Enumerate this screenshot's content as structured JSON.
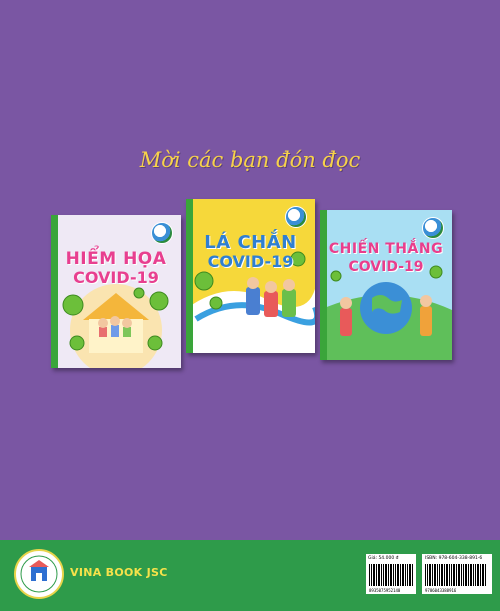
{
  "heading": "Mời các bạn đón đọc",
  "books": [
    {
      "title_line1": "HIỂM HỌA",
      "title_line2": "COVID-19"
    },
    {
      "title_line1": "LÁ CHẮN",
      "title_line2": "COVID-19"
    },
    {
      "title_line1": "CHIẾN THẮNG",
      "title_line2": "COVID-19"
    }
  ],
  "footer": {
    "brand": "VINA BOOK JSC",
    "price_label": "Giá: 54.000 đ",
    "isbn_label": "ISBN: 978-604-338-891-6",
    "barcode_left": "8935075952140",
    "barcode_right": "9786043388916"
  },
  "colors": {
    "background": "#7a56a3",
    "heading": "#f7d24a",
    "band": "#2e9b4a",
    "brand": "#f6e24a"
  }
}
